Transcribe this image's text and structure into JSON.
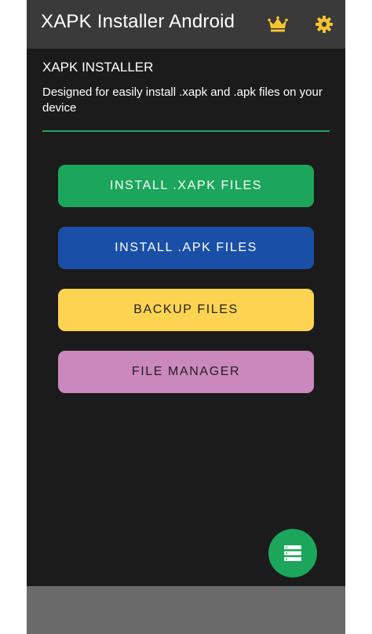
{
  "app": {
    "title": "XAPK Installer Android",
    "accent_color": "#1ba65b",
    "toolbar_icons": [
      "crown-icon",
      "gear-icon"
    ]
  },
  "main": {
    "section_title": "XAPK INSTALLER",
    "description": "Designed for easily install .xapk and .apk files on your device",
    "buttons": [
      {
        "label": "INSTALL .XAPK FILES",
        "color": "#1ba65b"
      },
      {
        "label": "INSTALL .APK FILES",
        "color": "#1a4fa8"
      },
      {
        "label": "BACKUP FILES",
        "color": "#fdd352"
      },
      {
        "label": "FILE MANAGER",
        "color": "#cb88bd"
      }
    ]
  },
  "fab": {
    "icon": "list-icon"
  }
}
